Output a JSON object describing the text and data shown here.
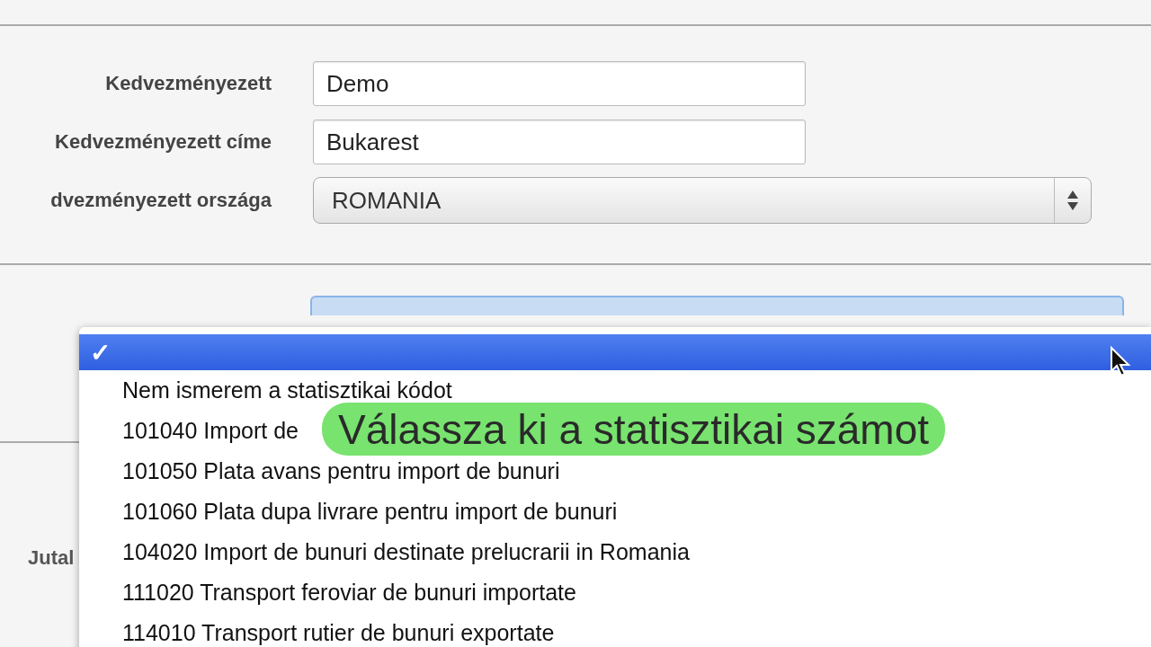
{
  "form": {
    "fields": [
      {
        "label": "Kedvezményezett",
        "kind": "text",
        "value": "Demo"
      },
      {
        "label": "Kedvezményezett címe",
        "kind": "text",
        "value": "Bukarest"
      },
      {
        "label": "dvezményezett országa",
        "kind": "select",
        "value": "ROMANIA"
      }
    ]
  },
  "lower_label": "Jutal",
  "dropdown": {
    "check_mark": "✓",
    "options": [
      {
        "selected": true
      },
      {
        "label": "Nem ismerem a statisztikai kódot",
        "selected": false
      },
      {
        "label": "101040 Import de",
        "selected": false
      },
      {
        "label": "101050 Plata avans pentru import de bunuri",
        "selected": false
      },
      {
        "label": "101060 Plata dupa livrare pentru import de bunuri",
        "selected": false
      },
      {
        "label": "104020 Import de bunuri destinate prelucrarii in Romania",
        "selected": false
      },
      {
        "label": "111020 Transport feroviar de bunuri importate",
        "selected": false
      },
      {
        "label": "114010 Transport rutier de bunuri exportate",
        "selected": false
      }
    ]
  },
  "caption": "Válassza ki a statisztikai számot"
}
